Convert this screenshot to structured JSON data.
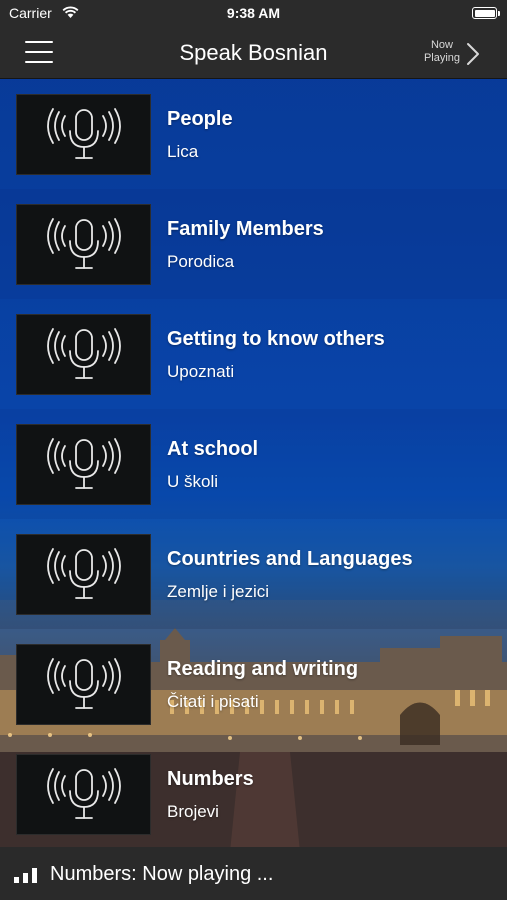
{
  "status_bar": {
    "carrier": "Carrier",
    "time": "9:38 AM"
  },
  "nav": {
    "title": "Speak Bosnian",
    "now_playing_line1": "Now",
    "now_playing_line2": "Playing"
  },
  "lessons": [
    {
      "title": "People",
      "subtitle": "Lica"
    },
    {
      "title": "Family Members",
      "subtitle": "Porodica"
    },
    {
      "title": "Getting to know others",
      "subtitle": "Upoznati"
    },
    {
      "title": "At school",
      "subtitle": "U školi"
    },
    {
      "title": "Countries and Languages",
      "subtitle": "Zemlje i jezici"
    },
    {
      "title": "Reading and writing",
      "subtitle": "Čitati i pisati"
    },
    {
      "title": "Numbers",
      "subtitle": "Brojevi"
    }
  ],
  "player": {
    "text": "Numbers: Now playing ..."
  },
  "icons": {
    "menu": "hamburger-menu-icon",
    "now_playing": "chevron-right-icon",
    "lesson_thumb": "microphone-broadcast-icon",
    "player": "signal-bars-icon",
    "wifi": "wifi-icon",
    "battery": "battery-icon"
  },
  "colors": {
    "bar_background": "#2b2b2b",
    "list_background_top": "#0b3fa8",
    "text": "#ffffff"
  }
}
